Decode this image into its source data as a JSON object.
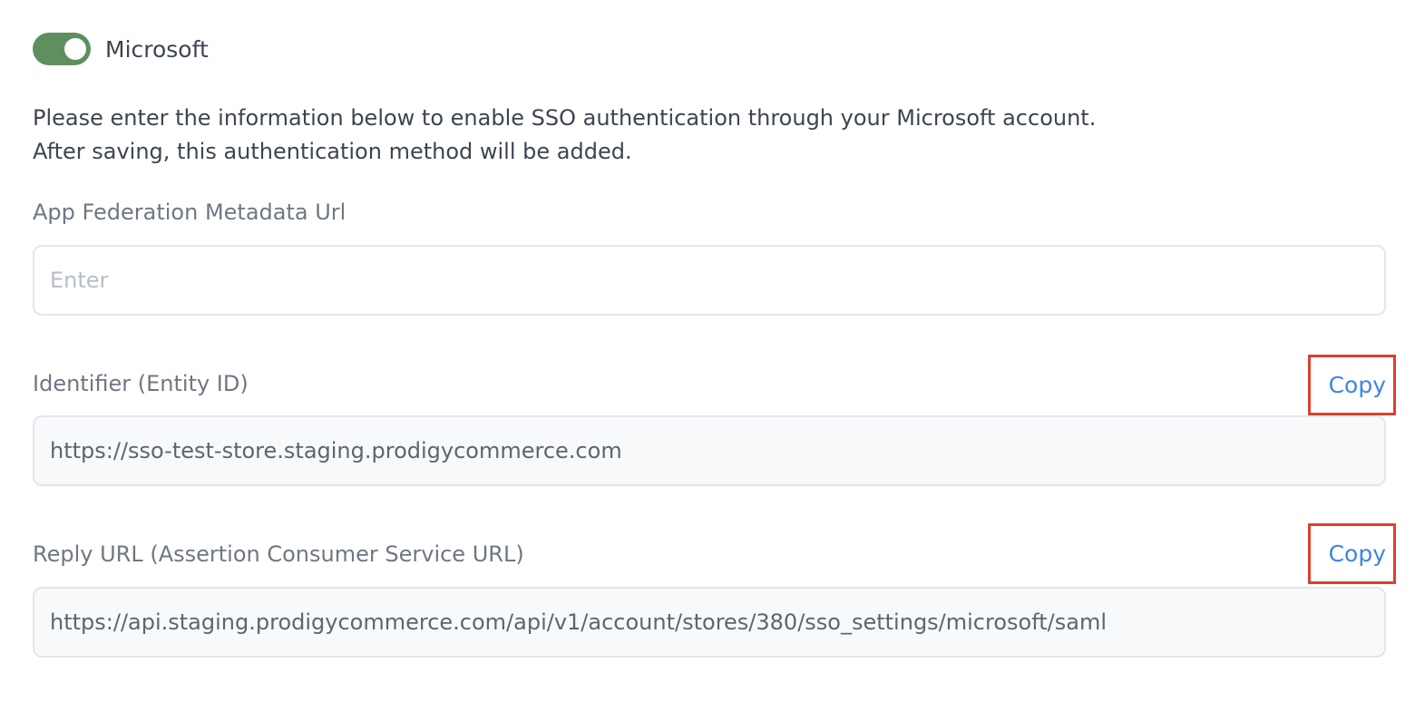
{
  "toggle": {
    "label": "Microsoft",
    "enabled": true,
    "on_color": "#5e8f5e"
  },
  "description": {
    "line1": "Please enter the information below to enable SSO authentication through your Microsoft account.",
    "line2": "After saving, this authentication method will be added."
  },
  "fields": {
    "metadata_url": {
      "label": "App Federation Metadata Url",
      "placeholder": "Enter",
      "value": ""
    },
    "identifier": {
      "label": "Identifier (Entity ID)",
      "value": "https://sso-test-store.staging.prodigycommerce.com",
      "copy_label": "Copy"
    },
    "reply_url": {
      "label": "Reply URL (Assertion Consumer Service URL)",
      "value": "https://api.staging.prodigycommerce.com/api/v1/account/stores/380/sso_settings/microsoft/saml",
      "copy_label": "Copy"
    }
  },
  "colors": {
    "link": "#3d86e0",
    "highlight_border": "#d9412f"
  }
}
